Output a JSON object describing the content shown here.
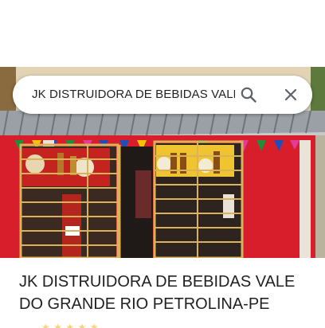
{
  "search": {
    "query": "JK DISTRUIDORA DE BEBIDAS VALE",
    "search_icon": "search-icon",
    "close_icon": "close-icon"
  },
  "place": {
    "title": "JK DISTRUIDORA DE BEBIDAS VALE DO GRANDE RIO PETROLINA-PE"
  },
  "colors": {
    "search_icon": "#5f6368",
    "wall_red": "#d81e2b",
    "gate_yellow": "#d9b25a",
    "title_text": "#202124"
  }
}
